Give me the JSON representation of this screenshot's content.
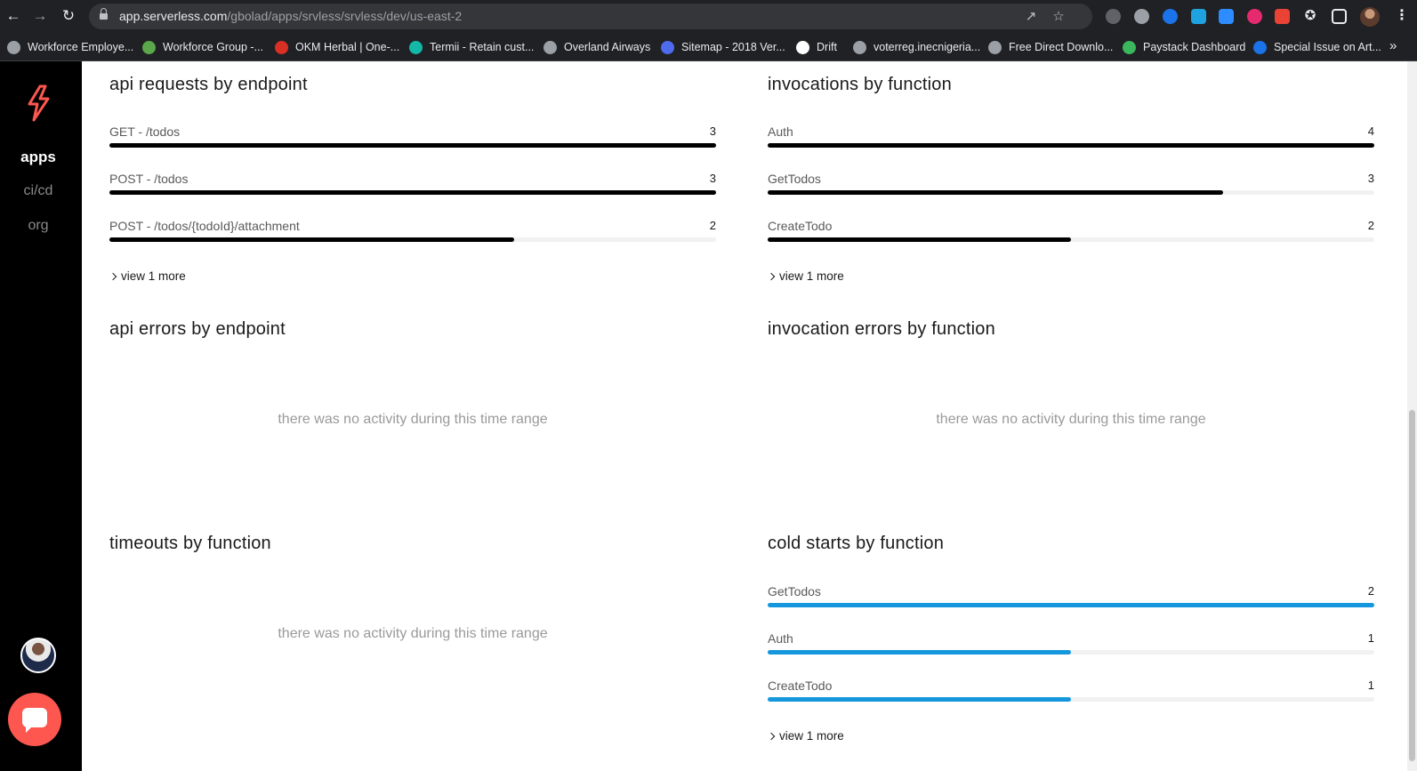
{
  "browser": {
    "url_host": "app.serverless.com",
    "url_path": "/gbolad/apps/srvless/srvless/dev/us-east-2",
    "bookmarks": [
      {
        "label": "Workforce Employe...",
        "color": "#9aa0a6"
      },
      {
        "label": "Workforce Group -...",
        "color": "#5aa84a"
      },
      {
        "label": "OKM Herbal | One-...",
        "color": "#d93025"
      },
      {
        "label": "Termii - Retain cust...",
        "color": "#14b8a6"
      },
      {
        "label": "Overland Airways",
        "color": "#9aa0a6"
      },
      {
        "label": "Sitemap - 2018 Ver...",
        "color": "#4f6bed"
      },
      {
        "label": "Drift",
        "color": "#ffffff"
      },
      {
        "label": "voterreg.inecnigeria...",
        "color": "#9aa0a6"
      },
      {
        "label": "Free Direct Downlo...",
        "color": "#9aa0a6"
      },
      {
        "label": "Paystack Dashboard",
        "color": "#3bb75e"
      },
      {
        "label": "Special Issue on Art...",
        "color": "#1a73e8"
      }
    ]
  },
  "sidebar": {
    "nav": [
      {
        "label": "apps",
        "active": true
      },
      {
        "label": "ci/cd",
        "active": false
      },
      {
        "label": "org",
        "active": false
      }
    ]
  },
  "panels": {
    "api_requests": {
      "title": "api requests by endpoint",
      "rows": [
        {
          "label": "GET - /todos",
          "value": "3",
          "fraction": 1.0
        },
        {
          "label": "POST - /todos",
          "value": "3",
          "fraction": 1.0
        },
        {
          "label": "POST - /todos/{todoId}/attachment",
          "value": "2",
          "fraction": 0.667
        }
      ],
      "view_more": "view 1 more"
    },
    "invocations": {
      "title": "invocations by function",
      "rows": [
        {
          "label": "Auth",
          "value": "4",
          "fraction": 1.0
        },
        {
          "label": "GetTodos",
          "value": "3",
          "fraction": 0.75
        },
        {
          "label": "CreateTodo",
          "value": "2",
          "fraction": 0.5
        }
      ],
      "view_more": "view 1 more"
    },
    "api_errors": {
      "title": "api errors by endpoint",
      "empty": "there was no activity during this time range"
    },
    "invocation_errors": {
      "title": "invocation errors by function",
      "empty": "there was no activity during this time range"
    },
    "timeouts": {
      "title": "timeouts by function",
      "empty": "there was no activity during this time range"
    },
    "cold_starts": {
      "title": "cold starts by function",
      "rows": [
        {
          "label": "GetTodos",
          "value": "2",
          "fraction": 1.0
        },
        {
          "label": "Auth",
          "value": "1",
          "fraction": 0.5
        },
        {
          "label": "CreateTodo",
          "value": "1",
          "fraction": 0.5
        }
      ],
      "view_more": "view 1 more"
    }
  },
  "colors": {
    "bar_primary": "#000000",
    "bar_cold_start": "#1597dd",
    "brand": "#fd5750"
  }
}
